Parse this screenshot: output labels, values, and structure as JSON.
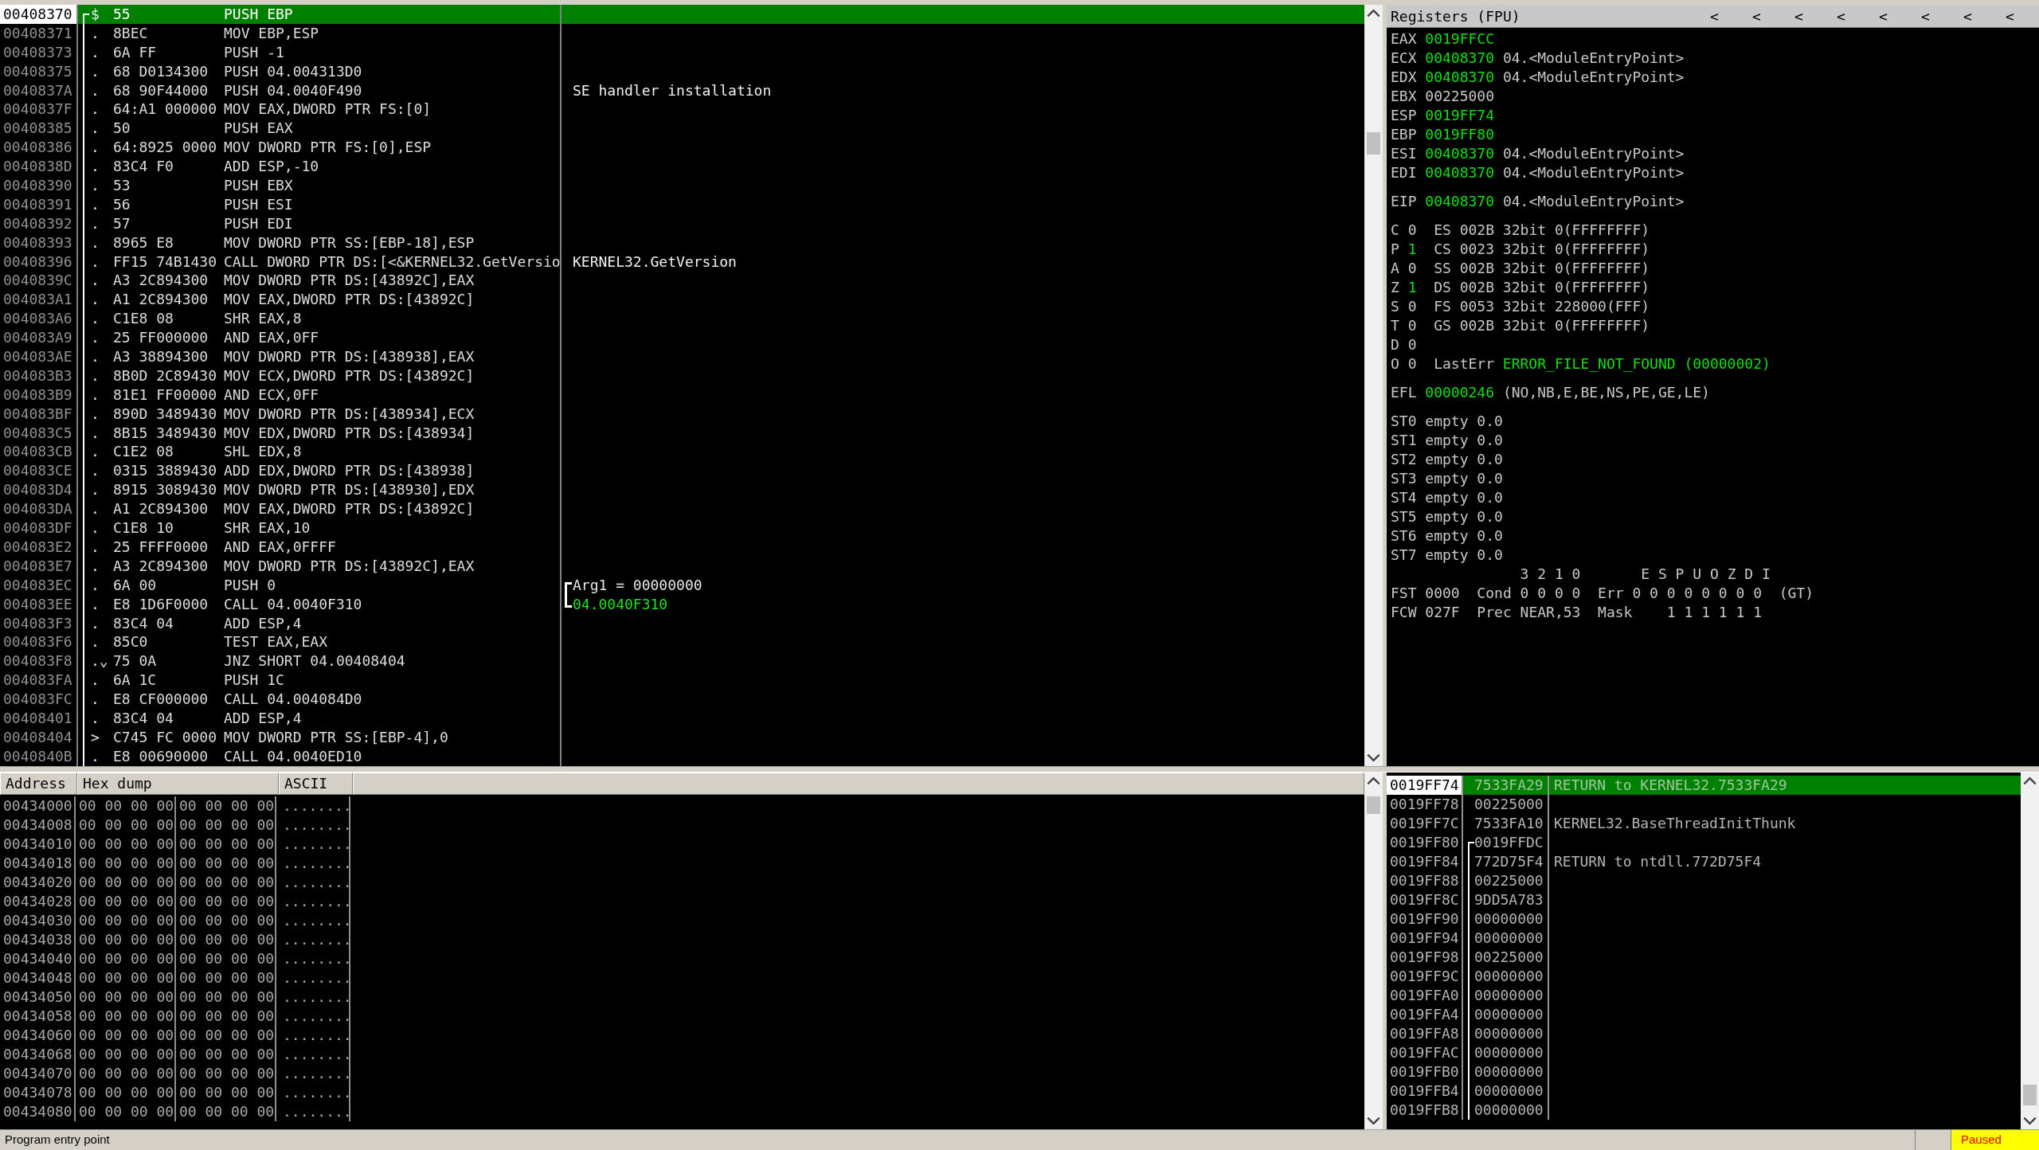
{
  "disassembly": {
    "rows": [
      {
        "address": "00408370",
        "marker": "$",
        "hex": "55",
        "instruction": "PUSH EBP",
        "selected": true,
        "function_start": true
      },
      {
        "address": "00408371",
        "marker": ".",
        "hex": "8BEC",
        "instruction": "MOV EBP,ESP",
        "selected": false,
        "function_start": false
      },
      {
        "address": "00408373",
        "marker": ".",
        "hex": "6A FF",
        "instruction": "PUSH -1",
        "selected": false,
        "function_start": false
      },
      {
        "address": "00408375",
        "marker": ".",
        "hex": "68 D0134300",
        "instruction": "PUSH 04.004313D0",
        "selected": false,
        "function_start": false
      },
      {
        "address": "0040837A",
        "marker": ".",
        "hex": "68 90F44000",
        "instruction": "PUSH 04.0040F490",
        "selected": false,
        "function_start": false,
        "comment": {
          "text": "SE handler installation",
          "kind": "plain"
        }
      },
      {
        "address": "0040837F",
        "marker": ".",
        "hex": "64:A1 000000",
        "instruction": "MOV EAX,DWORD PTR FS:[0]",
        "selected": false,
        "function_start": false
      },
      {
        "address": "00408385",
        "marker": ".",
        "hex": "50",
        "instruction": "PUSH EAX",
        "selected": false,
        "function_start": false
      },
      {
        "address": "00408386",
        "marker": ".",
        "hex": "64:8925 0000",
        "instruction": "MOV DWORD PTR FS:[0],ESP",
        "selected": false,
        "function_start": false
      },
      {
        "address": "0040838D",
        "marker": ".",
        "hex": "83C4 F0",
        "instruction": "ADD ESP,-10",
        "selected": false,
        "function_start": false
      },
      {
        "address": "00408390",
        "marker": ".",
        "hex": "53",
        "instruction": "PUSH EBX",
        "selected": false,
        "function_start": false
      },
      {
        "address": "00408391",
        "marker": ".",
        "hex": "56",
        "instruction": "PUSH ESI",
        "selected": false,
        "function_start": false
      },
      {
        "address": "00408392",
        "marker": ".",
        "hex": "57",
        "instruction": "PUSH EDI",
        "selected": false,
        "function_start": false
      },
      {
        "address": "00408393",
        "marker": ".",
        "hex": "8965 E8",
        "instruction": "MOV DWORD PTR SS:[EBP-18],ESP",
        "selected": false,
        "function_start": false
      },
      {
        "address": "00408396",
        "marker": ".",
        "hex": "FF15 74B1430",
        "instruction": "CALL DWORD PTR DS:[<&KERNEL32.GetVersio",
        "selected": false,
        "function_start": false,
        "comment": {
          "text": "KERNEL32.GetVersion",
          "kind": "plain"
        }
      },
      {
        "address": "0040839C",
        "marker": ".",
        "hex": "A3 2C894300",
        "instruction": "MOV DWORD PTR DS:[43892C],EAX",
        "selected": false,
        "function_start": false
      },
      {
        "address": "004083A1",
        "marker": ".",
        "hex": "A1 2C894300",
        "instruction": "MOV EAX,DWORD PTR DS:[43892C]",
        "selected": false,
        "function_start": false
      },
      {
        "address": "004083A6",
        "marker": ".",
        "hex": "C1E8 08",
        "instruction": "SHR EAX,8",
        "selected": false,
        "function_start": false
      },
      {
        "address": "004083A9",
        "marker": ".",
        "hex": "25 FF000000",
        "instruction": "AND EAX,0FF",
        "selected": false,
        "function_start": false
      },
      {
        "address": "004083AE",
        "marker": ".",
        "hex": "A3 38894300",
        "instruction": "MOV DWORD PTR DS:[438938],EAX",
        "selected": false,
        "function_start": false
      },
      {
        "address": "004083B3",
        "marker": ".",
        "hex": "8B0D 2C89430",
        "instruction": "MOV ECX,DWORD PTR DS:[43892C]",
        "selected": false,
        "function_start": false
      },
      {
        "address": "004083B9",
        "marker": ".",
        "hex": "81E1 FF00000",
        "instruction": "AND ECX,0FF",
        "selected": false,
        "function_start": false
      },
      {
        "address": "004083BF",
        "marker": ".",
        "hex": "890D 3489430",
        "instruction": "MOV DWORD PTR DS:[438934],ECX",
        "selected": false,
        "function_start": false
      },
      {
        "address": "004083C5",
        "marker": ".",
        "hex": "8B15 3489430",
        "instruction": "MOV EDX,DWORD PTR DS:[438934]",
        "selected": false,
        "function_start": false
      },
      {
        "address": "004083CB",
        "marker": ".",
        "hex": "C1E2 08",
        "instruction": "SHL EDX,8",
        "selected": false,
        "function_start": false
      },
      {
        "address": "004083CE",
        "marker": ".",
        "hex": "0315 3889430",
        "instruction": "ADD EDX,DWORD PTR DS:[438938]",
        "selected": false,
        "function_start": false
      },
      {
        "address": "004083D4",
        "marker": ".",
        "hex": "8915 3089430",
        "instruction": "MOV DWORD PTR DS:[438930],EDX",
        "selected": false,
        "function_start": false
      },
      {
        "address": "004083DA",
        "marker": ".",
        "hex": "A1 2C894300",
        "instruction": "MOV EAX,DWORD PTR DS:[43892C]",
        "selected": false,
        "function_start": false
      },
      {
        "address": "004083DF",
        "marker": ".",
        "hex": "C1E8 10",
        "instruction": "SHR EAX,10",
        "selected": false,
        "function_start": false
      },
      {
        "address": "004083E2",
        "marker": ".",
        "hex": "25 FFFF0000",
        "instruction": "AND EAX,0FFFF",
        "selected": false,
        "function_start": false
      },
      {
        "address": "004083E7",
        "marker": ".",
        "hex": "A3 2C894300",
        "instruction": "MOV DWORD PTR DS:[43892C],EAX",
        "selected": false,
        "function_start": false
      },
      {
        "address": "004083EC",
        "marker": ".",
        "hex": "6A 00",
        "instruction": "PUSH 0",
        "selected": false,
        "function_start": false,
        "comment": {
          "text": "Arg1 = 00000000",
          "kind": "arg"
        }
      },
      {
        "address": "004083EE",
        "marker": ".",
        "hex": "E8 1D6F0000",
        "instruction": "CALL 04.0040F310",
        "selected": false,
        "function_start": false,
        "comment": {
          "text": "04.0040F310",
          "kind": "call"
        }
      },
      {
        "address": "004083F3",
        "marker": ".",
        "hex": "83C4 04",
        "instruction": "ADD ESP,4",
        "selected": false,
        "function_start": false
      },
      {
        "address": "004083F6",
        "marker": ".",
        "hex": "85C0",
        "instruction": "TEST EAX,EAX",
        "selected": false,
        "function_start": false
      },
      {
        "address": "004083F8",
        "marker": ".⌄",
        "hex": "75 0A",
        "instruction": "JNZ SHORT 04.00408404",
        "selected": false,
        "function_start": false
      },
      {
        "address": "004083FA",
        "marker": ".",
        "hex": "6A 1C",
        "instruction": "PUSH 1C",
        "selected": false,
        "function_start": false
      },
      {
        "address": "004083FC",
        "marker": ".",
        "hex": "E8 CF000000",
        "instruction": "CALL 04.004084D0",
        "selected": false,
        "function_start": false
      },
      {
        "address": "00408401",
        "marker": ".",
        "hex": "83C4 04",
        "instruction": "ADD ESP,4",
        "selected": false,
        "function_start": false
      },
      {
        "address": "00408404",
        "marker": ">",
        "hex": "C745 FC 0000",
        "instruction": "MOV DWORD PTR SS:[EBP-4],0",
        "selected": false,
        "function_start": false
      },
      {
        "address": "0040840B",
        "marker": ".",
        "hex": "E8 00690000",
        "instruction": "CALL 04.0040ED10",
        "selected": false,
        "function_start": false
      }
    ]
  },
  "registers": {
    "title": "Registers (FPU)",
    "header_buttons": [
      "<",
      "<",
      "<",
      "<",
      "<",
      "<",
      "<",
      "<"
    ],
    "general": [
      {
        "name": "EAX",
        "value": "0019FFCC",
        "changed": true
      },
      {
        "name": "ECX",
        "value": "00408370",
        "changed": true,
        "comment": "04.<ModuleEntryPoint>"
      },
      {
        "name": "EDX",
        "value": "00408370",
        "changed": true,
        "comment": "04.<ModuleEntryPoint>"
      },
      {
        "name": "EBX",
        "value": "00225000",
        "changed": false
      },
      {
        "name": "ESP",
        "value": "0019FF74",
        "changed": true
      },
      {
        "name": "EBP",
        "value": "0019FF80",
        "changed": true
      },
      {
        "name": "ESI",
        "value": "00408370",
        "changed": true,
        "comment": "04.<ModuleEntryPoint>"
      },
      {
        "name": "EDI",
        "value": "00408370",
        "changed": true,
        "comment": "04.<ModuleEntryPoint>"
      }
    ],
    "eip": {
      "name": "EIP",
      "value": "00408370",
      "changed": true,
      "comment": "04.<ModuleEntryPoint>"
    },
    "flags": [
      {
        "name": "C",
        "value": "0",
        "changed": false,
        "segment": "ES 002B 32bit 0(FFFFFFFF)"
      },
      {
        "name": "P",
        "value": "1",
        "changed": true,
        "segment": "CS 0023 32bit 0(FFFFFFFF)"
      },
      {
        "name": "A",
        "value": "0",
        "changed": false,
        "segment": "SS 002B 32bit 0(FFFFFFFF)"
      },
      {
        "name": "Z",
        "value": "1",
        "changed": true,
        "segment": "DS 002B 32bit 0(FFFFFFFF)"
      },
      {
        "name": "S",
        "value": "0",
        "changed": false,
        "segment": "FS 0053 32bit 228000(FFF)"
      },
      {
        "name": "T",
        "value": "0",
        "changed": false,
        "segment": "GS 002B 32bit 0(FFFFFFFF)"
      },
      {
        "name": "D",
        "value": "0",
        "changed": false
      },
      {
        "name": "O",
        "value": "0",
        "changed": false,
        "last_error_label": "LastErr",
        "last_error": "ERROR_FILE_NOT_FOUND (00000002)"
      }
    ],
    "efl": {
      "name": "EFL",
      "value": "00000246",
      "changed": true,
      "comment": "(NO,NB,E,BE,NS,PE,GE,LE)"
    },
    "fpu_stack": [
      {
        "name": "ST0",
        "text": "empty 0.0"
      },
      {
        "name": "ST1",
        "text": "empty 0.0"
      },
      {
        "name": "ST2",
        "text": "empty 0.0"
      },
      {
        "name": "ST3",
        "text": "empty 0.0"
      },
      {
        "name": "ST4",
        "text": "empty 0.0"
      },
      {
        "name": "ST5",
        "text": "empty 0.0"
      },
      {
        "name": "ST6",
        "text": "empty 0.0"
      },
      {
        "name": "ST7",
        "text": "empty 0.0"
      }
    ],
    "fpu_bits_header": "3 2 1 0       E S P U O Z D I",
    "fpu_status": [
      {
        "name": "FST",
        "text": "0000  Cond 0 0 0 0  Err 0 0 0 0 0 0 0 0  (GT)"
      },
      {
        "name": "FCW",
        "text": "027F  Prec NEAR,53  Mask    1 1 1 1 1 1"
      }
    ]
  },
  "dump": {
    "columns": [
      "Address",
      "Hex dump",
      "ASCII"
    ],
    "rows": [
      {
        "address": "00434000",
        "hex": [
          "00 00 00 00",
          "00 00 00 00"
        ],
        "ascii": "........"
      },
      {
        "address": "00434008",
        "hex": [
          "00 00 00 00",
          "00 00 00 00"
        ],
        "ascii": "........"
      },
      {
        "address": "00434010",
        "hex": [
          "00 00 00 00",
          "00 00 00 00"
        ],
        "ascii": "........"
      },
      {
        "address": "00434018",
        "hex": [
          "00 00 00 00",
          "00 00 00 00"
        ],
        "ascii": "........"
      },
      {
        "address": "00434020",
        "hex": [
          "00 00 00 00",
          "00 00 00 00"
        ],
        "ascii": "........"
      },
      {
        "address": "00434028",
        "hex": [
          "00 00 00 00",
          "00 00 00 00"
        ],
        "ascii": "........"
      },
      {
        "address": "00434030",
        "hex": [
          "00 00 00 00",
          "00 00 00 00"
        ],
        "ascii": "........"
      },
      {
        "address": "00434038",
        "hex": [
          "00 00 00 00",
          "00 00 00 00"
        ],
        "ascii": "........"
      },
      {
        "address": "00434040",
        "hex": [
          "00 00 00 00",
          "00 00 00 00"
        ],
        "ascii": "........"
      },
      {
        "address": "00434048",
        "hex": [
          "00 00 00 00",
          "00 00 00 00"
        ],
        "ascii": "........"
      },
      {
        "address": "00434050",
        "hex": [
          "00 00 00 00",
          "00 00 00 00"
        ],
        "ascii": "........"
      },
      {
        "address": "00434058",
        "hex": [
          "00 00 00 00",
          "00 00 00 00"
        ],
        "ascii": "........"
      },
      {
        "address": "00434060",
        "hex": [
          "00 00 00 00",
          "00 00 00 00"
        ],
        "ascii": "........"
      },
      {
        "address": "00434068",
        "hex": [
          "00 00 00 00",
          "00 00 00 00"
        ],
        "ascii": "........"
      },
      {
        "address": "00434070",
        "hex": [
          "00 00 00 00",
          "00 00 00 00"
        ],
        "ascii": "........"
      },
      {
        "address": "00434078",
        "hex": [
          "00 00 00 00",
          "00 00 00 00"
        ],
        "ascii": "........"
      },
      {
        "address": "00434080",
        "hex": [
          "00 00 00 00",
          "00 00 00 00"
        ],
        "ascii": "........"
      }
    ]
  },
  "stack": {
    "rows": [
      {
        "address": "0019FF74",
        "value": "7533FA29",
        "comment": "RETURN to KERNEL32.7533FA29",
        "selected": true,
        "frame_start": false
      },
      {
        "address": "0019FF78",
        "value": "00225000",
        "selected": false,
        "frame_start": false
      },
      {
        "address": "0019FF7C",
        "value": "7533FA10",
        "comment": "KERNEL32.BaseThreadInitThunk",
        "selected": false,
        "frame_start": false
      },
      {
        "address": "0019FF80",
        "value": "0019FFDC",
        "selected": false,
        "frame_start": true
      },
      {
        "address": "0019FF84",
        "value": "772D75F4",
        "comment": "RETURN to ntdll.772D75F4",
        "selected": false,
        "frame_start": false
      },
      {
        "address": "0019FF88",
        "value": "00225000",
        "selected": false,
        "frame_start": false
      },
      {
        "address": "0019FF8C",
        "value": "9DD5A783",
        "selected": false,
        "frame_start": false
      },
      {
        "address": "0019FF90",
        "value": "00000000",
        "selected": false,
        "frame_start": false
      },
      {
        "address": "0019FF94",
        "value": "00000000",
        "selected": false,
        "frame_start": false
      },
      {
        "address": "0019FF98",
        "value": "00225000",
        "selected": false,
        "frame_start": false
      },
      {
        "address": "0019FF9C",
        "value": "00000000",
        "selected": false,
        "frame_start": false
      },
      {
        "address": "0019FFA0",
        "value": "00000000",
        "selected": false,
        "frame_start": false
      },
      {
        "address": "0019FFA4",
        "value": "00000000",
        "selected": false,
        "frame_start": false
      },
      {
        "address": "0019FFA8",
        "value": "00000000",
        "selected": false,
        "frame_start": false
      },
      {
        "address": "0019FFAC",
        "value": "00000000",
        "selected": false,
        "frame_start": false
      },
      {
        "address": "0019FFB0",
        "value": "00000000",
        "selected": false,
        "frame_start": false
      },
      {
        "address": "0019FFB4",
        "value": "00000000",
        "selected": false,
        "frame_start": false
      },
      {
        "address": "0019FFB8",
        "value": "00000000",
        "selected": false,
        "frame_start": false
      }
    ]
  },
  "status_bar": {
    "message": "Program entry point",
    "state": "Paused"
  }
}
